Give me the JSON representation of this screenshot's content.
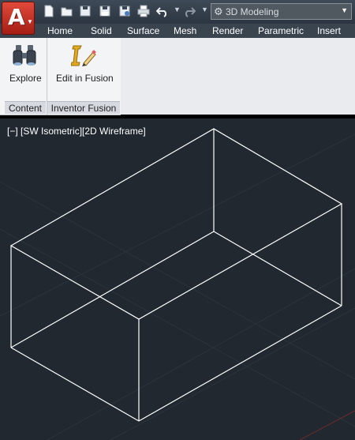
{
  "quick_access": {
    "workspace": "3D Modeling"
  },
  "ribbon": {
    "tabs": [
      "Home",
      "Solid",
      "Surface",
      "Mesh",
      "Render",
      "Parametric",
      "Insert"
    ],
    "tools": {
      "explore": "Explore",
      "edit_in_fusion": "Edit in Fusion"
    },
    "panels": {
      "content": "Content",
      "inventor_fusion": "Inventor Fusion"
    }
  },
  "viewport": {
    "controls": "[−]",
    "view": "[SW Isometric]",
    "visual_style": "[2D Wireframe]"
  },
  "colors": {
    "app_button": "#c8301f",
    "canvas_background": "#212830",
    "wireframe": "#ffffff"
  },
  "icons": [
    "application-menu-icon",
    "new-icon",
    "open-icon",
    "save-icon",
    "save-as-icon",
    "plot-icon",
    "undo-icon",
    "redo-icon",
    "gear-icon",
    "binoculars-icon",
    "fusion-icon"
  ]
}
